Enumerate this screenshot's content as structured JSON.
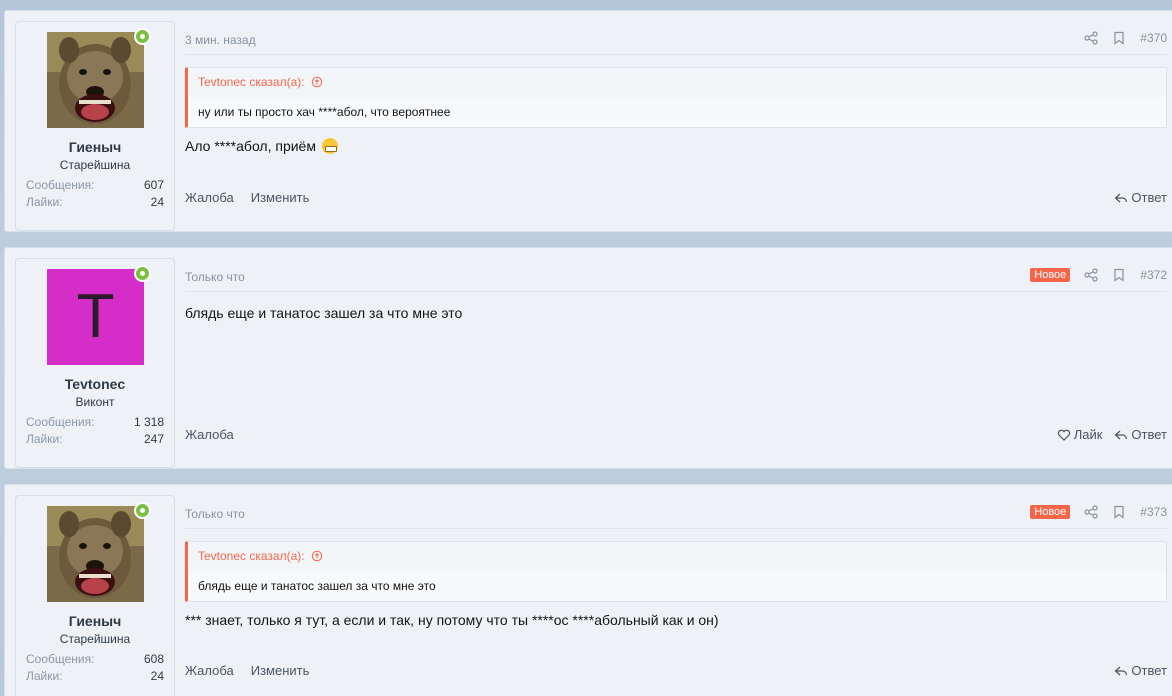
{
  "posts": [
    {
      "user": {
        "name": "Гиеныч",
        "title": "Старейшина",
        "messages_label": "Сообщения:",
        "messages": "607",
        "likes_label": "Лайки:",
        "likes": "24",
        "avatar": "hyena-photo"
      },
      "time": "3 мин. назад",
      "badge": "",
      "number": "#370",
      "quote": {
        "author": "Tevtonec сказал(а):",
        "text": "ну или ты просто хач ****абол, что вероятнее"
      },
      "text": "Ало ****абол, приём",
      "footer": {
        "report": "Жалоба",
        "edit": "Изменить",
        "reply": "Ответ"
      }
    },
    {
      "user": {
        "name": "Tevtonec",
        "title": "Виконт",
        "messages_label": "Сообщения:",
        "messages": "1 318",
        "likes_label": "Лайки:",
        "likes": "247",
        "avatar_letter": "T"
      },
      "time": "Только что",
      "badge": "Новое",
      "number": "#372",
      "text": "блядь еще и танатос зашел за что мне это",
      "footer": {
        "report": "Жалоба",
        "like": "Лайк",
        "reply": "Ответ"
      }
    },
    {
      "user": {
        "name": "Гиеныч",
        "title": "Старейшина",
        "messages_label": "Сообщения:",
        "messages": "608",
        "likes_label": "Лайки:",
        "likes": "24",
        "avatar": "hyena-photo"
      },
      "time": "Только что",
      "badge": "Новое",
      "number": "#373",
      "quote": {
        "author": "Tevtonec сказал(а):",
        "text": "блядь еще и танатос зашел за что мне это"
      },
      "text": "*** знает, только я тут, а если и так, ну потому что ты ****ос ****абольный как и он)",
      "footer": {
        "report": "Жалоба",
        "edit": "Изменить",
        "reply": "Ответ"
      }
    }
  ],
  "colors": {
    "accent": "#f5654a",
    "online": "#7ac142",
    "avatar_bg": "#d52ec8"
  },
  "icons": {
    "share": "share-icon",
    "bookmark": "bookmark-icon",
    "reply": "reply-icon",
    "like": "heart-icon",
    "quote_up": "arrow-up-circle-icon",
    "emoji": "grinning-emoji-icon"
  }
}
